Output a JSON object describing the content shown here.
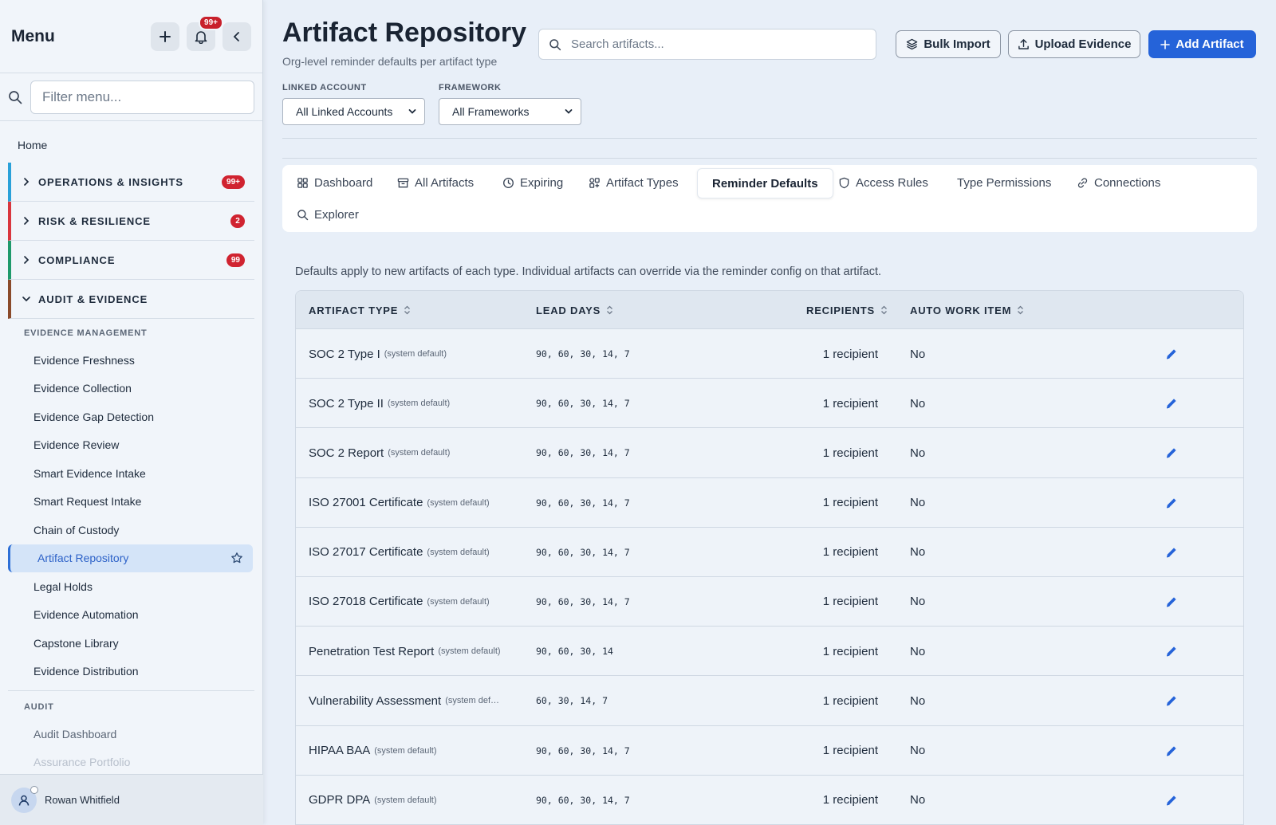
{
  "sidebar": {
    "title": "Menu",
    "notif_badge": "99+",
    "filter_placeholder": "Filter menu...",
    "home": "Home",
    "groups": [
      {
        "label": "OPERATIONS & INSIGHTS",
        "badge": "99+",
        "color": "#2aa1d9"
      },
      {
        "label": "RISK & RESILIENCE",
        "badge": "2",
        "color": "#d9363e"
      },
      {
        "label": "COMPLIANCE",
        "badge": "99",
        "color": "#1f9a6b"
      },
      {
        "label": "AUDIT & EVIDENCE",
        "badge": "",
        "color": "#8a4a2a"
      }
    ],
    "evidence_section": "EVIDENCE MANAGEMENT",
    "evidence_items": [
      "Evidence Freshness",
      "Evidence Collection",
      "Evidence Gap Detection",
      "Evidence Review",
      "Smart Evidence Intake",
      "Smart Request Intake",
      "Chain of Custody",
      "Artifact Repository",
      "Legal Holds",
      "Evidence Automation",
      "Capstone Library",
      "Evidence Distribution"
    ],
    "audit_section": "AUDIT",
    "audit_items": [
      "Audit Dashboard",
      "Assurance Portfolio"
    ],
    "user_name": "Rowan Whitfield"
  },
  "header": {
    "title": "Artifact Repository",
    "subtitle": "Org-level reminder defaults per artifact type",
    "search_placeholder": "Search artifacts...",
    "bulk_import": "Bulk Import",
    "upload_evidence": "Upload Evidence",
    "add_artifact": "Add Artifact"
  },
  "filters": {
    "linked_account_label": "LINKED ACCOUNT",
    "linked_account_value": "All Linked Accounts",
    "framework_label": "FRAMEWORK",
    "framework_value": "All Frameworks"
  },
  "tabs": [
    "Dashboard",
    "All Artifacts",
    "Expiring",
    "Artifact Types",
    "Reminder Defaults",
    "Access Rules",
    "Type Permissions",
    "Connections",
    "Explorer"
  ],
  "active_tab": "Reminder Defaults",
  "description": "Defaults apply to new artifacts of each type. Individual artifacts can override via the reminder config on that artifact.",
  "table": {
    "headers": [
      "ARTIFACT TYPE",
      "LEAD DAYS",
      "RECIPIENTS",
      "AUTO WORK ITEM"
    ],
    "rows": [
      {
        "type": "SOC 2 Type I",
        "tag": "(system default)",
        "lead": "90, 60, 30, 14, 7",
        "recipients": "1 recipient",
        "auto": "No"
      },
      {
        "type": "SOC 2 Type II",
        "tag": "(system default)",
        "lead": "90, 60, 30, 14, 7",
        "recipients": "1 recipient",
        "auto": "No"
      },
      {
        "type": "SOC 2 Report",
        "tag": "(system default)",
        "lead": "90, 60, 30, 14, 7",
        "recipients": "1 recipient",
        "auto": "No"
      },
      {
        "type": "ISO 27001 Certificate",
        "tag": "(system default)",
        "lead": "90, 60, 30, 14, 7",
        "recipients": "1 recipient",
        "auto": "No"
      },
      {
        "type": "ISO 27017 Certificate",
        "tag": "(system default)",
        "lead": "90, 60, 30, 14, 7",
        "recipients": "1 recipient",
        "auto": "No"
      },
      {
        "type": "ISO 27018 Certificate",
        "tag": "(system default)",
        "lead": "90, 60, 30, 14, 7",
        "recipients": "1 recipient",
        "auto": "No"
      },
      {
        "type": "Penetration Test Report",
        "tag": "(system default)",
        "lead": "90, 60, 30, 14",
        "recipients": "1 recipient",
        "auto": "No"
      },
      {
        "type": "Vulnerability Assessment",
        "tag": "(system def…",
        "lead": "60, 30, 14, 7",
        "recipients": "1 recipient",
        "auto": "No"
      },
      {
        "type": "HIPAA BAA",
        "tag": "(system default)",
        "lead": "90, 60, 30, 14, 7",
        "recipients": "1 recipient",
        "auto": "No"
      },
      {
        "type": "GDPR DPA",
        "tag": "(system default)",
        "lead": "90, 60, 30, 14, 7",
        "recipients": "1 recipient",
        "auto": "No"
      }
    ]
  },
  "colors": {
    "accent": "#2563d9",
    "badge": "#d02330"
  }
}
